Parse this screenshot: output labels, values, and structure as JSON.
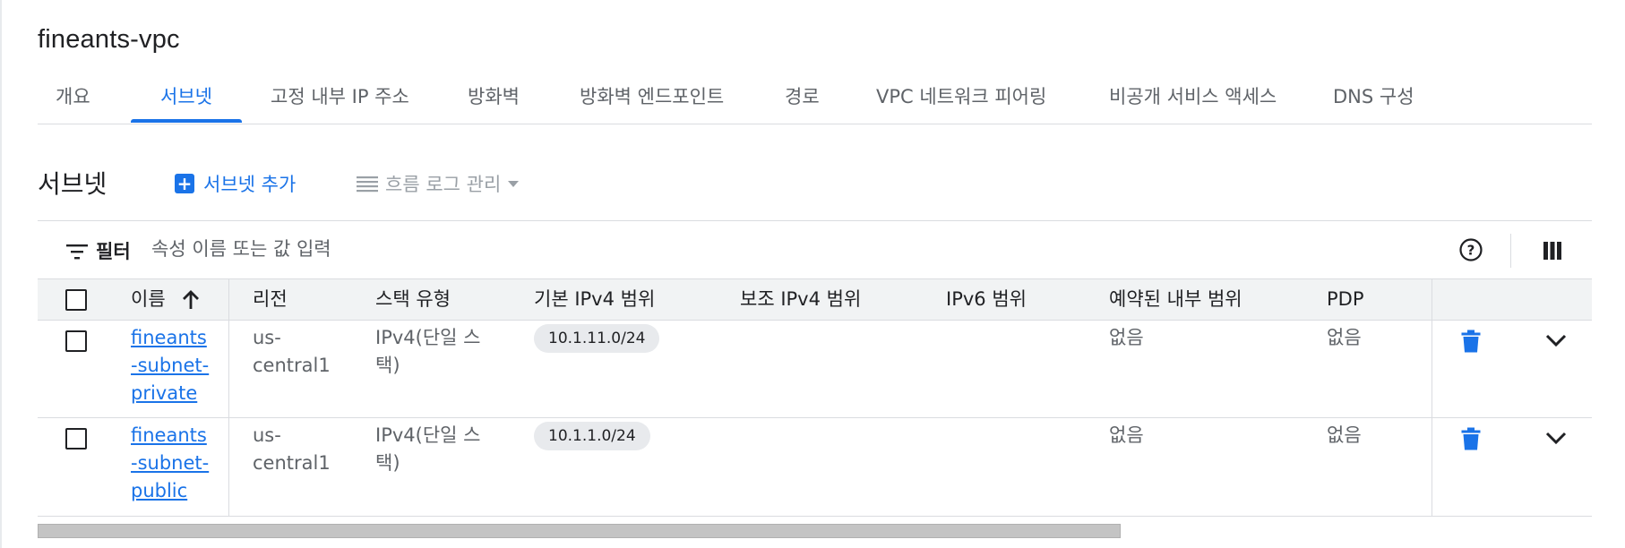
{
  "page": {
    "title": "fineants-vpc"
  },
  "tabs": [
    {
      "label": "개요"
    },
    {
      "label": "서브넷"
    },
    {
      "label": "고정 내부 IP 주소"
    },
    {
      "label": "방화벽"
    },
    {
      "label": "방화벽 엔드포인트"
    },
    {
      "label": "경로"
    },
    {
      "label": "VPC 네트워크 피어링"
    },
    {
      "label": "비공개 서비스 액세스"
    },
    {
      "label": "DNS 구성"
    }
  ],
  "active_tab": "서브넷",
  "section": {
    "title": "서브넷",
    "add_label": "서브넷 추가",
    "flow_logs_label": "흐름 로그 관리"
  },
  "filter": {
    "label": "필터",
    "placeholder": "속성 이름 또는 값 입력"
  },
  "table": {
    "headers": [
      "이름",
      "리전",
      "스택 유형",
      "기본 IPv4 범위",
      "보조 IPv4 범위",
      "IPv6 범위",
      "예약된 내부 범위",
      "PDP"
    ],
    "sort": {
      "column": "이름",
      "direction": "ascending"
    },
    "rows": [
      {
        "name": "fineants-subnet-private",
        "region": "us-central1",
        "stack_type": "IPv4(단일 스택)",
        "primary_ipv4": "10.1.11.0/24",
        "secondary_ipv4": "",
        "ipv6": "",
        "reserved_internal": "없음",
        "pdp": "없음"
      },
      {
        "name": "fineants-subnet-public",
        "region": "us-central1",
        "stack_type": "IPv4(단일 스택)",
        "primary_ipv4": "10.1.1.0/24",
        "secondary_ipv4": "",
        "ipv6": "",
        "reserved_internal": "없음",
        "pdp": "없음"
      }
    ]
  },
  "colors": {
    "accent": "#1a73e8",
    "text": "#202124",
    "muted": "#5f6368",
    "disabled": "#9aa0a6",
    "header_bg": "#f1f3f4",
    "chip_bg": "#e8eaed",
    "border": "#dadce0"
  },
  "icons": {
    "add": "plus-square-icon",
    "flow_logs": "list-lines-icon",
    "filter": "filter-lines-icon",
    "help": "help-circle-icon",
    "columns": "column-display-icon",
    "sort": "arrow-up-icon",
    "delete": "trash-icon",
    "expand": "chevron-down-icon"
  }
}
